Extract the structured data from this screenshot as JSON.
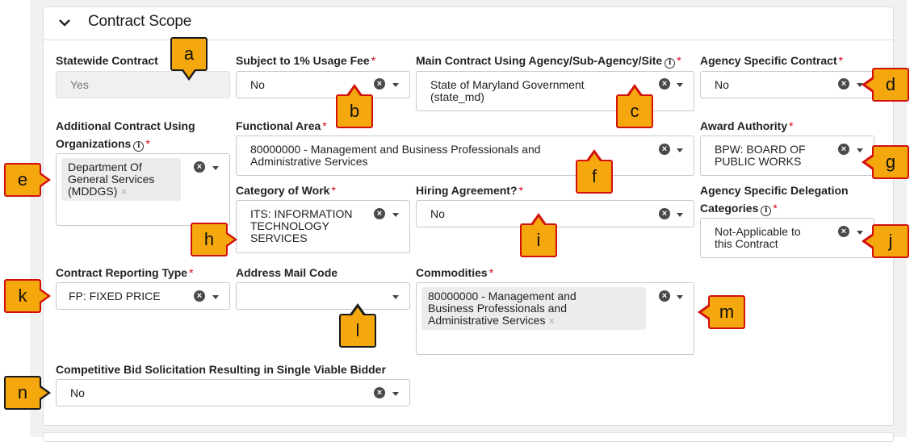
{
  "section": {
    "title": "Contract Scope"
  },
  "fields": {
    "statewide": {
      "label": "Statewide Contract",
      "value": "Yes"
    },
    "usage_fee": {
      "label": "Subject to 1% Usage Fee",
      "value": "No"
    },
    "main_agency": {
      "label": "Main Contract Using Agency/Sub-Agency/Site",
      "value_line1": "State of Maryland Government",
      "value_line2": "(state_md)"
    },
    "agency_specific": {
      "label": "Agency Specific Contract",
      "value": "No"
    },
    "additional_orgs": {
      "label_line1": "Additional Contract Using",
      "label_line2": "Organizations",
      "chip_line1": "Department Of",
      "chip_line2": "General Services",
      "chip_line3": "(MDDGS)"
    },
    "functional_area": {
      "label": "Functional Area",
      "value_line1": "80000000 - Management and Business Professionals and",
      "value_line2": "Administrative Services"
    },
    "award_authority": {
      "label": "Award Authority",
      "value_line1": "BPW: BOARD OF",
      "value_line2": "PUBLIC WORKS"
    },
    "category_work": {
      "label": "Category of Work",
      "value_line1": "ITS: INFORMATION",
      "value_line2": "TECHNOLOGY",
      "value_line3": "SERVICES"
    },
    "hiring_agreement": {
      "label": "Hiring Agreement?",
      "value": "No"
    },
    "delegation": {
      "label_line1": "Agency Specific Delegation",
      "label_line2": "Categories",
      "value_line1": "Not-Applicable to",
      "value_line2": "this Contract"
    },
    "reporting_type": {
      "label": "Contract Reporting Type",
      "value": "FP: FIXED PRICE"
    },
    "mail_code": {
      "label": "Address Mail Code",
      "value": ""
    },
    "commodities": {
      "label": "Commodities",
      "chip_line1": "80000000 - Management and",
      "chip_line2": "Business Professionals and",
      "chip_line3": "Administrative Services"
    },
    "single_bidder": {
      "label": "Competitive Bid Solicitation Resulting in Single Viable Bidder",
      "value": "No"
    }
  },
  "required_mark": "*",
  "info_glyph": "i",
  "clear_glyph": "×",
  "chip_remove_glyph": "×",
  "callouts": [
    "a",
    "b",
    "c",
    "d",
    "e",
    "f",
    "g",
    "h",
    "i",
    "j",
    "k",
    "l",
    "m",
    "n"
  ],
  "colors": {
    "callout_fill": "#f5a80d",
    "callout_border": "#d2100c",
    "required": "#d0021b"
  }
}
